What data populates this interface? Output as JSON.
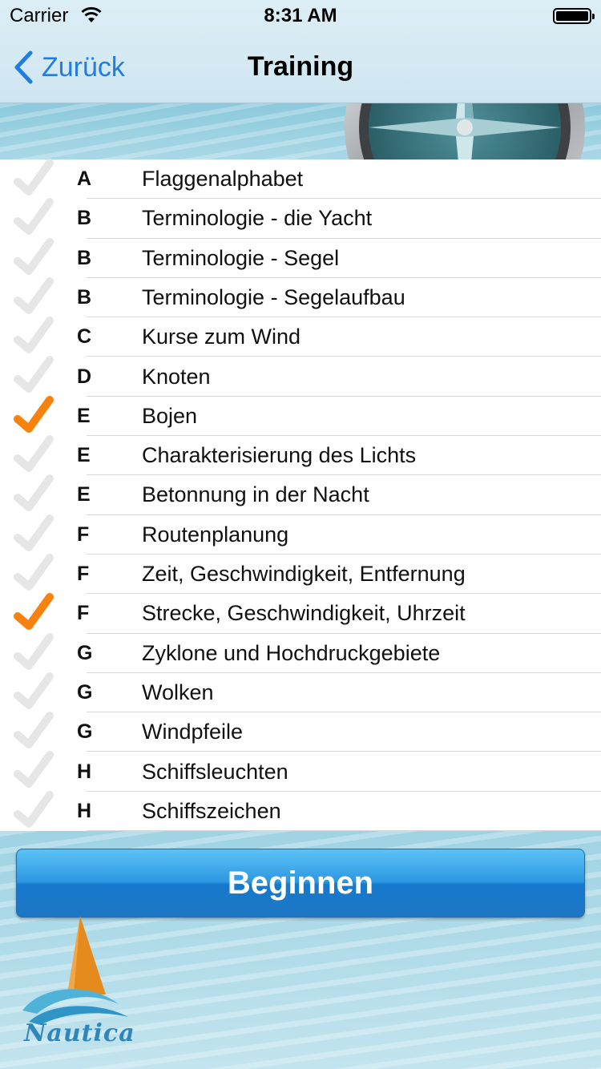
{
  "status_bar": {
    "carrier": "Carrier",
    "time": "8:31 AM"
  },
  "nav": {
    "back_label": "Zurück",
    "title": "Training"
  },
  "items": [
    {
      "letter": "A",
      "label": "Flaggenalphabet",
      "checked": false
    },
    {
      "letter": "B",
      "label": "Terminologie - die Yacht",
      "checked": false
    },
    {
      "letter": "B",
      "label": "Terminologie - Segel",
      "checked": false
    },
    {
      "letter": "B",
      "label": "Terminologie - Segelaufbau",
      "checked": false
    },
    {
      "letter": "C",
      "label": "Kurse zum Wind",
      "checked": false
    },
    {
      "letter": "D",
      "label": "Knoten",
      "checked": false
    },
    {
      "letter": "E",
      "label": "Bojen",
      "checked": true
    },
    {
      "letter": "E",
      "label": "Charakterisierung des Lichts",
      "checked": false
    },
    {
      "letter": "E",
      "label": "Betonnung in der Nacht",
      "checked": false
    },
    {
      "letter": "F",
      "label": "Routenplanung",
      "checked": false
    },
    {
      "letter": "F",
      "label": "Zeit, Geschwindigkeit, Entfernung",
      "checked": false
    },
    {
      "letter": "F",
      "label": "Strecke, Geschwindigkeit, Uhrzeit",
      "checked": true
    },
    {
      "letter": "G",
      "label": "Zyklone und Hochdruckgebiete",
      "checked": false
    },
    {
      "letter": "G",
      "label": "Wolken",
      "checked": false
    },
    {
      "letter": "G",
      "label": "Windpfeile",
      "checked": false
    },
    {
      "letter": "H",
      "label": "Schiffsleuchten",
      "checked": false
    },
    {
      "letter": "H",
      "label": "Schiffszeichen",
      "checked": false
    }
  ],
  "start_button": {
    "label": "Beginnen"
  },
  "logo": {
    "text": "Nautica"
  },
  "colors": {
    "accent": "#1f7ee0",
    "check_on": "#f7820f",
    "check_off": "#e6e6e6",
    "button": "#2d98e2"
  },
  "icons": {
    "back": "chevron-left-icon",
    "check": "checkmark-icon",
    "wifi": "wifi-icon",
    "battery": "battery-icon"
  }
}
